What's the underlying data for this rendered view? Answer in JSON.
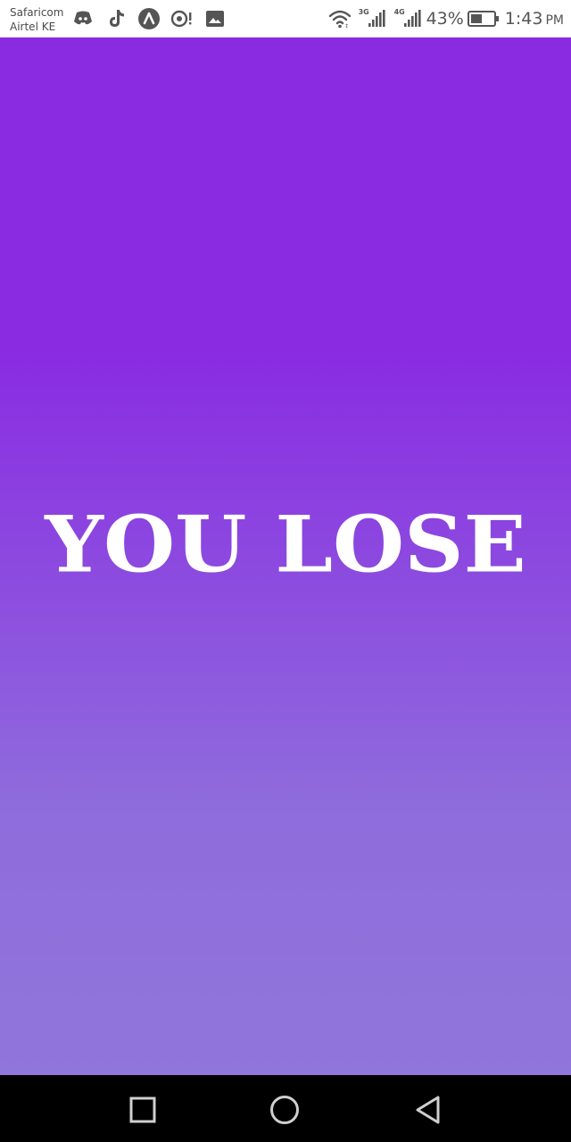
{
  "status_bar": {
    "carrier_1": "Safaricom",
    "carrier_2": "Airtel KE",
    "notification_icons": [
      "discord-icon",
      "tiktok-icon",
      "app-icon",
      "notification-icon",
      "gallery-icon"
    ],
    "system_icons": [
      "wifi-icon",
      "signal-icon",
      "signal-icon",
      "battery-icon"
    ],
    "network_1": "3G",
    "network_2": "4G",
    "battery_percent": "43%",
    "time": "1:43",
    "am_pm": "PM"
  },
  "game": {
    "result_text": "YOU LOSE",
    "gradient_top": "#8a2be2",
    "gradient_bottom": "#9075db",
    "text_color": "#ffffff"
  },
  "nav_bar": {
    "buttons": [
      "recents-button",
      "home-button",
      "back-button"
    ]
  }
}
